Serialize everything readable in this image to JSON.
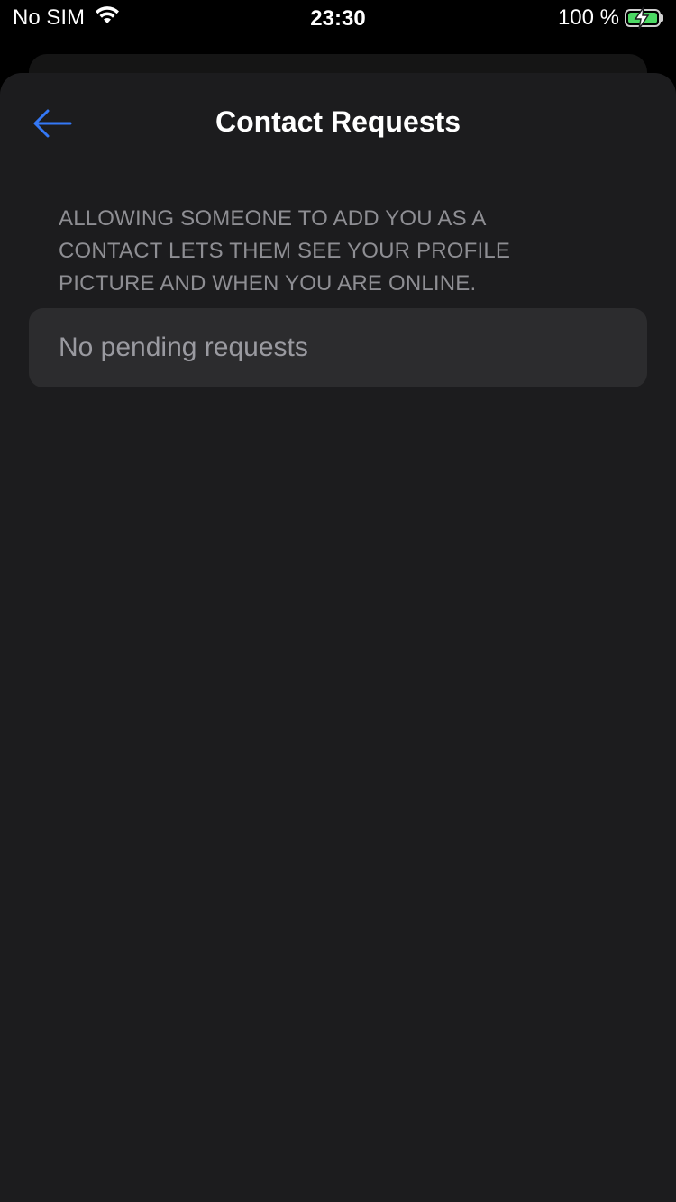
{
  "status_bar": {
    "carrier": "No SIM",
    "time": "23:30",
    "battery_percent": "100 %",
    "battery_level": 1.0,
    "battery_color": "#4cd964",
    "icons": [
      "wifi-icon",
      "battery-charging-icon"
    ]
  },
  "nav": {
    "title": "Contact Requests",
    "back_icon": "arrow-left-icon",
    "accent_color": "#3478f6"
  },
  "section": {
    "header": "ALLOWING SOMEONE TO ADD YOU AS A CONTACT LETS THEM SEE YOUR PROFILE PICTURE AND WHEN YOU ARE ONLINE.",
    "empty_text": "No pending requests"
  }
}
